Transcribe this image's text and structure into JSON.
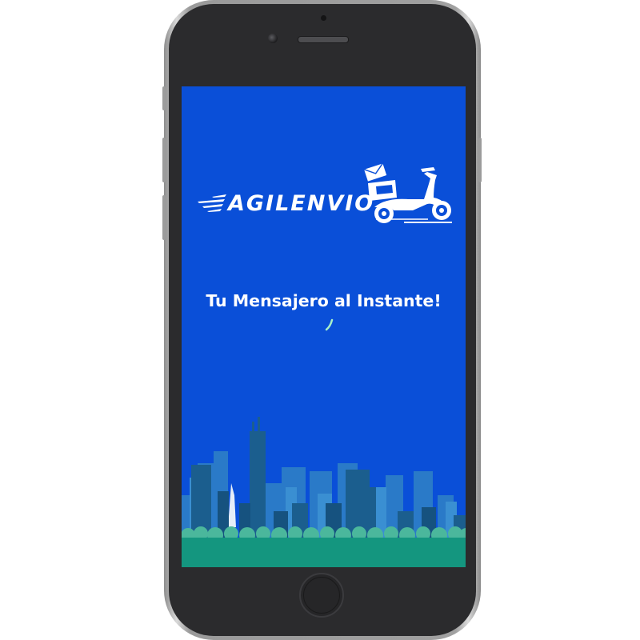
{
  "app": {
    "logo_text": "AGILENVIO",
    "tagline": "Tu Mensajero al Instante!"
  },
  "colors": {
    "screen_bg": "#0a4fd8",
    "ground": "#14967f",
    "logo": "#ffffff"
  },
  "icons": {
    "logo": "scooter-delivery-icon",
    "loading": "loading-spinner-icon",
    "illustration": "city-skyline"
  }
}
